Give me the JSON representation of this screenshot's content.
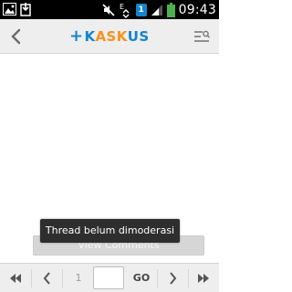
{
  "status_bar": {
    "time": "09:43",
    "sim_badge": "1",
    "network_type": "E",
    "icons": [
      "image-notification-icon",
      "sync-icon",
      "mute-icon",
      "signal-icon",
      "sim-icon",
      "wifi-signal-icon",
      "battery-icon"
    ]
  },
  "app_bar": {
    "logo_text_prefix": "K",
    "logo_text_mid": "ASK",
    "logo_text_suffix": "US",
    "back_icon": "chevron-left-icon",
    "menu_icon": "menu-search-icon",
    "colors": {
      "logo_blue": "#1484ce",
      "logo_orange": "#f7921e"
    }
  },
  "content": {
    "view_comments_label": "View Comments",
    "toast_text": "Thread belum dimoderasi"
  },
  "pagination": {
    "current_page": "1",
    "page_input_value": "",
    "go_label": "GO",
    "icons": [
      "first-page-icon",
      "prev-page-icon",
      "next-page-icon",
      "last-page-icon"
    ]
  }
}
